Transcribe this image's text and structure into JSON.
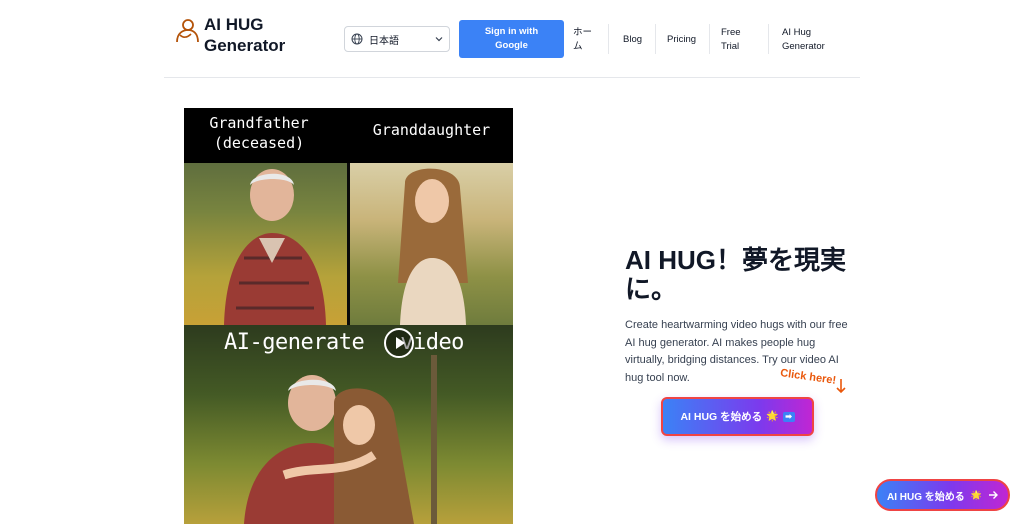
{
  "header": {
    "logo_text": "AI HUG Generator",
    "language": {
      "selected": "日本語"
    },
    "signin_label": "Sign in with Google",
    "nav": [
      {
        "label": "ホーム"
      },
      {
        "label": "Blog"
      },
      {
        "label": "Pricing"
      },
      {
        "label": "Free Trial"
      },
      {
        "label": "AI Hug Generator"
      }
    ]
  },
  "video": {
    "caption_left": "Grandfather (deceased)",
    "caption_right": "Granddaughter",
    "caption_bottom_left": "AI-generate",
    "caption_bottom_right": "video"
  },
  "hero": {
    "title": "AI HUG！夢を現実に。",
    "description": "Create heartwarming video hugs with our free AI hug generator. AI makes people hug virtually, bridging distances. Try our video AI hug tool now.",
    "click_here": "Click here!",
    "cta_label": "AI HUG を始める"
  },
  "floating_button": {
    "label": "AI HUG を始める"
  },
  "colors": {
    "primary": "#3b82f6",
    "accent": "#7c3aed",
    "click_here": "#ea580c"
  }
}
